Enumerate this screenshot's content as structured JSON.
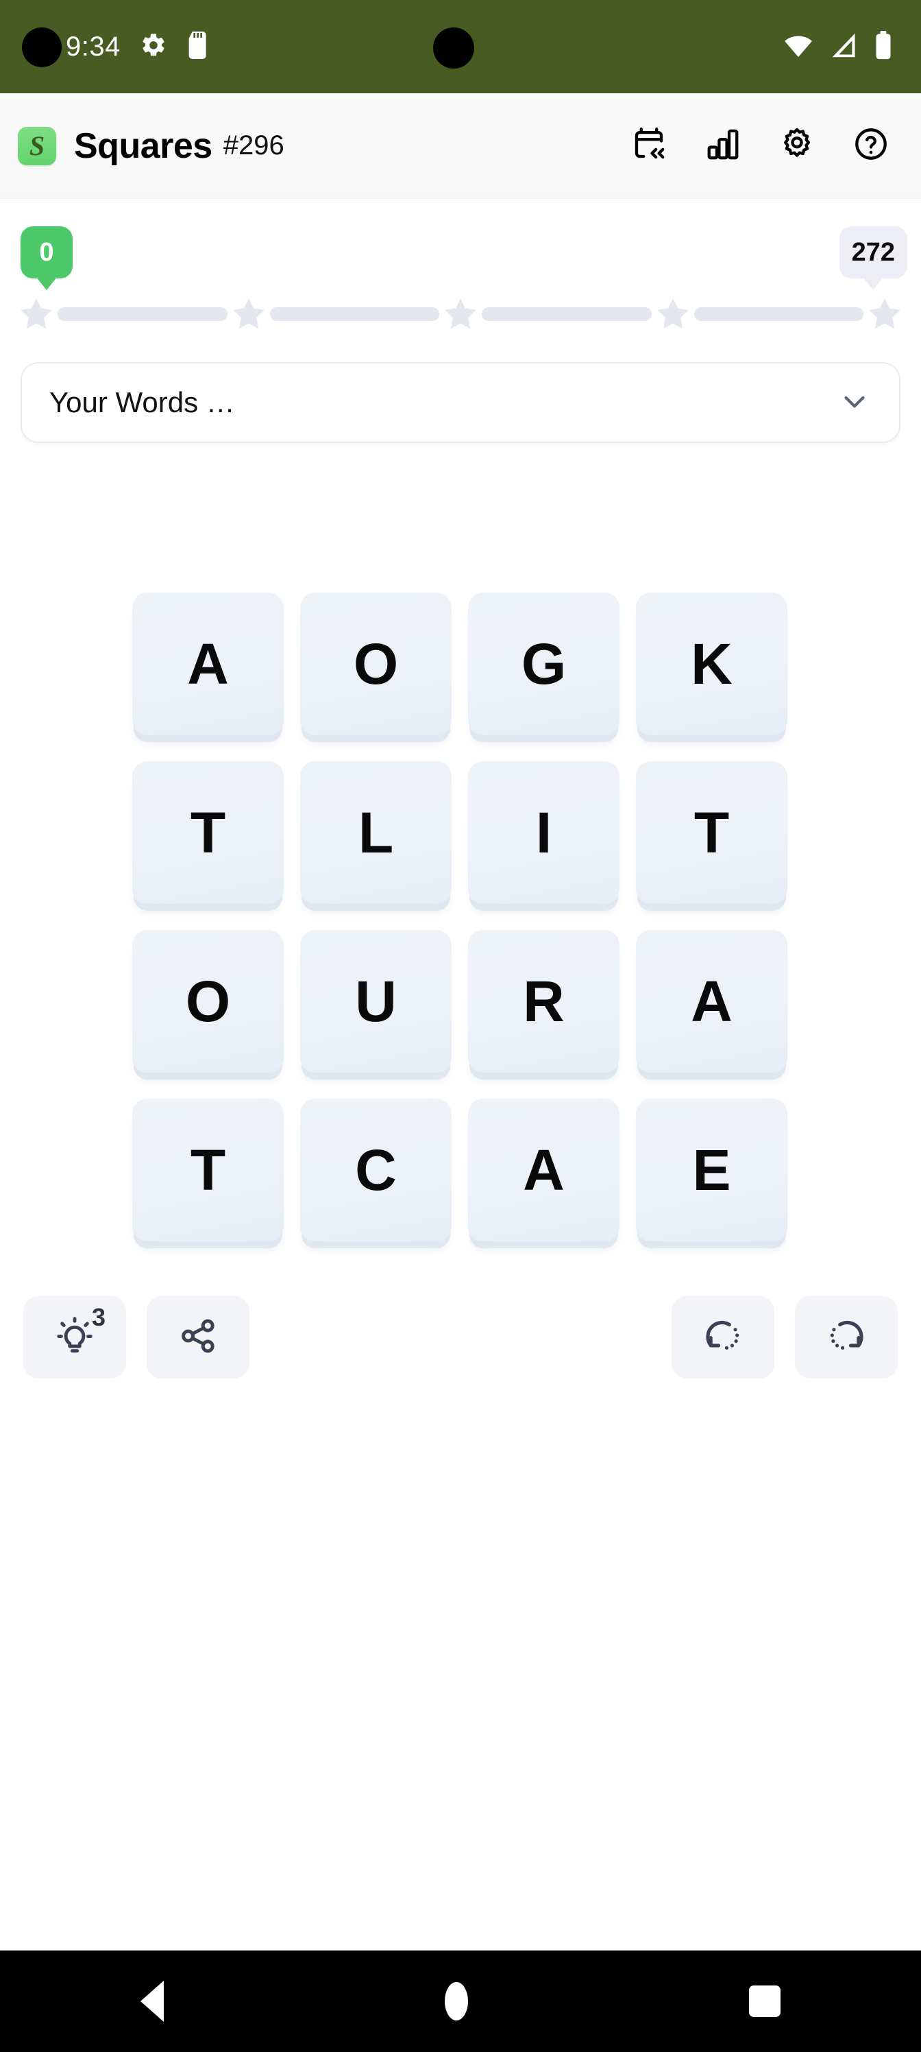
{
  "status_bar": {
    "time": "9:34",
    "icons": [
      "gear-icon",
      "sd-card-icon",
      "wifi-icon",
      "cellular-icon",
      "battery-icon"
    ],
    "background_color": "#465c22"
  },
  "app_bar": {
    "logo_letter": "S",
    "title": "Squares",
    "puzzle_number": "#296",
    "actions": [
      {
        "name": "archive-icon",
        "label": "Archive"
      },
      {
        "name": "stats-icon",
        "label": "Statistics"
      },
      {
        "name": "gear-icon",
        "label": "Settings"
      },
      {
        "name": "help-icon",
        "label": "Help"
      }
    ]
  },
  "progress": {
    "current_score": "0",
    "max_score": "272",
    "stars_total": 5,
    "stars_earned": 0,
    "score_badge_color": "#4ec96a",
    "max_badge_color": "#eceef3",
    "star_color": "#e4e7ee",
    "segment_color": "#e5e7ef"
  },
  "your_words": {
    "label": "Your Words …",
    "chevron": "chevron-down-icon",
    "expanded": false
  },
  "board": {
    "rows": 4,
    "cols": 4,
    "letters": [
      [
        "A",
        "O",
        "G",
        "K"
      ],
      [
        "T",
        "L",
        "I",
        "T"
      ],
      [
        "O",
        "U",
        "R",
        "A"
      ],
      [
        "T",
        "C",
        "A",
        "E"
      ]
    ],
    "tile_color": "#eef3f8"
  },
  "actions": {
    "hint": {
      "name": "hint-icon",
      "count": "3"
    },
    "share": {
      "name": "share-icon"
    },
    "undo": {
      "name": "undo-icon"
    },
    "redo": {
      "name": "redo-icon"
    }
  },
  "nav_bar": {
    "back": "back-icon",
    "home": "home-icon",
    "recents": "recents-icon"
  }
}
